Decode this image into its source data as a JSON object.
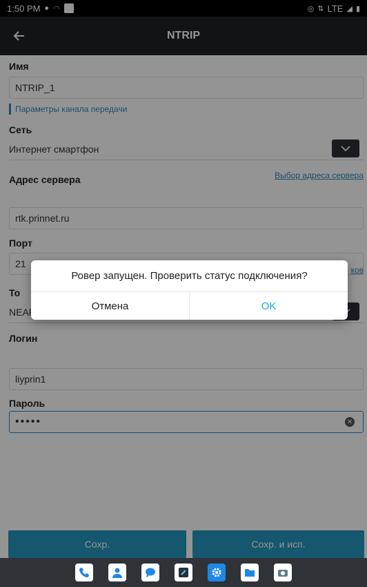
{
  "status": {
    "time": "1:50 PM",
    "network": "LTE"
  },
  "appbar": {
    "title": "NTRIP",
    "back_icon": "arrow-left-icon"
  },
  "form": {
    "name_label": "Имя",
    "name_value": "NTRIP_1",
    "section_title": "Параметры канала передачи",
    "network_label": "Сеть",
    "network_value": "Интернет смартфон",
    "server_select_link": "Выбор адреса сервера",
    "server_label": "Адрес сервера",
    "server_value": "rtk.prinnet.ru",
    "port_label": "Порт",
    "port_value_partial": "21",
    "mount_link_partial": "ков",
    "mount_label_partial": "То",
    "mount_value": "NEAREST_RTCM32",
    "login_label": "Логин",
    "login_value": "liyprin1",
    "password_label": "Пароль",
    "password_value": "•••••"
  },
  "buttons": {
    "save": "Сохр.",
    "save_use": "Сохр. и исп."
  },
  "dialog": {
    "message": "Ровер запущен. Проверить статус подключения?",
    "cancel": "Отмена",
    "ok": "OK"
  },
  "colors": {
    "accent": "#2596be",
    "link": "#2e86c1",
    "appbar": "#1e2228"
  }
}
